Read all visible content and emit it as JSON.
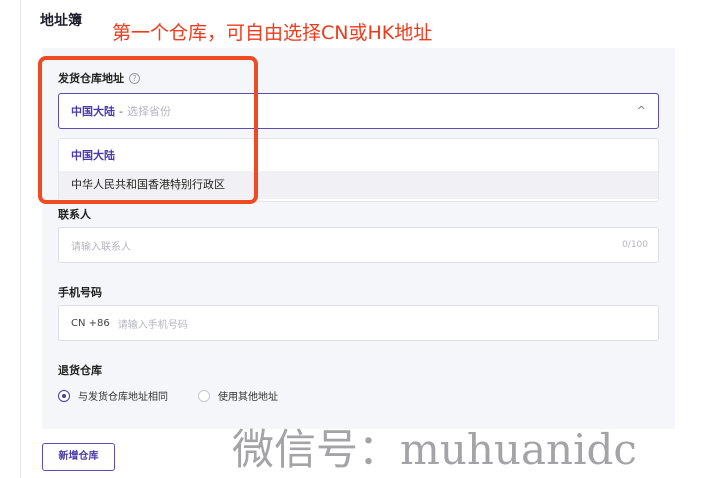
{
  "section": {
    "title": "地址簿"
  },
  "annotation": {
    "text": "第一个仓库，可自由选择CN或HK地址"
  },
  "warehouse_address": {
    "label": "发货仓库地址",
    "help_icon": "?",
    "selected": "中国大陆",
    "separator": "-",
    "placeholder": "选择省份",
    "chevron": "^",
    "options": [
      {
        "label": "中国大陆"
      },
      {
        "label": "中华人民共和国香港特别行政区"
      }
    ]
  },
  "contact": {
    "label": "联系人",
    "placeholder": "请输入联系人",
    "counter": "0/100"
  },
  "phone": {
    "label": "手机号码",
    "prefix": "CN +86",
    "placeholder": "请输入手机号码"
  },
  "return_warehouse": {
    "label": "退货仓库",
    "options": [
      {
        "label": "与发货仓库地址相同",
        "checked": true
      },
      {
        "label": "使用其他地址",
        "checked": false
      }
    ]
  },
  "add_button": {
    "label": "新增仓库"
  },
  "watermark": {
    "text": "微信号：muhuanidc"
  },
  "colors": {
    "accent": "#4b3ba8",
    "annotation": "#ee3b1b",
    "highlight": "#f04a22",
    "panel": "#f5f6fa"
  }
}
